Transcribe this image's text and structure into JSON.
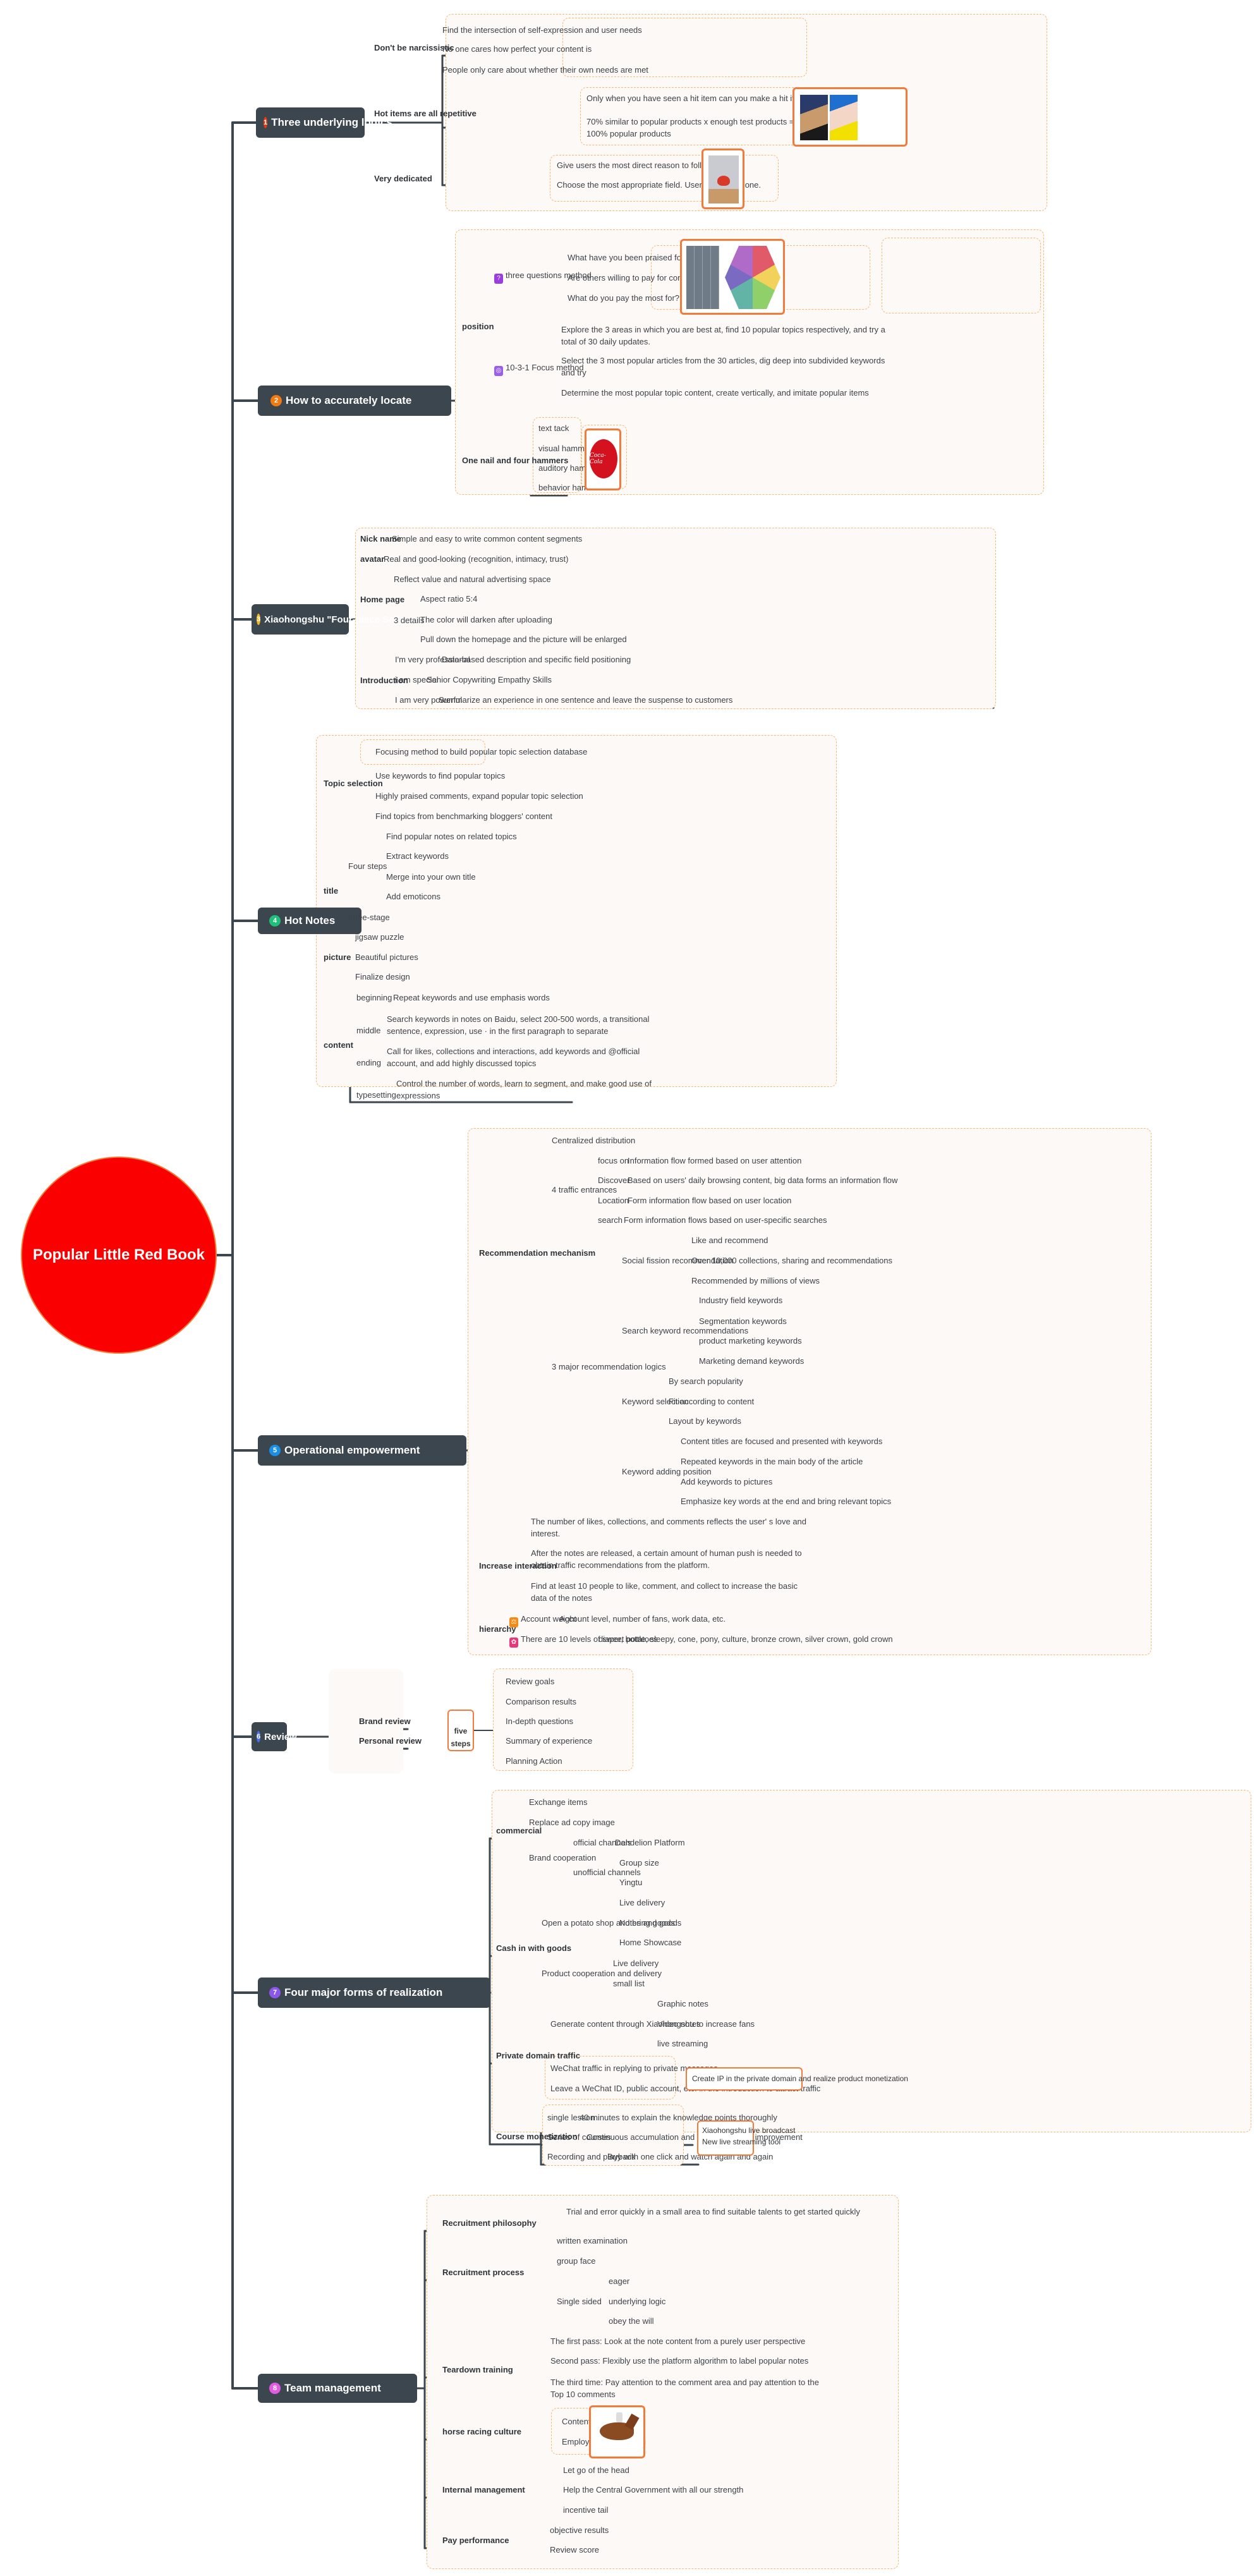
{
  "root": {
    "label": "Popular Little Red Book",
    "color": "#fb0000"
  },
  "topics": [
    {
      "num": "1",
      "label": "Three underlying logics",
      "badge_color": "#e8380d"
    },
    {
      "num": "2",
      "label": "How to accurately locate",
      "badge_color": "#f07a10"
    },
    {
      "num": "3",
      "label": "Xiaohongshu \"Four-piece Set\"",
      "badge_color": "#f3b61d"
    },
    {
      "num": "4",
      "label": "Hot Notes",
      "badge_color": "#1fc07a"
    },
    {
      "num": "5",
      "label": "Operational empowerment",
      "badge_color": "#1a8fe8"
    },
    {
      "num": "6",
      "label": "Review",
      "badge_color": "#4a6ef0"
    },
    {
      "num": "7",
      "label": "Four major forms of realization",
      "badge_color": "#8a57e8"
    },
    {
      "num": "8",
      "label": "Team management",
      "badge_color": "#e25ce3"
    }
  ],
  "t1": {
    "b1": "Don't be narcissistic",
    "b1_items": [
      "Find the intersection of self-expression and user needs",
      "No one cares how perfect your content is",
      "People only care about whether their own needs are met"
    ],
    "b2": "Hot items are all repetitive",
    "b2_items": [
      "Only when you have seen a hit item can you make a hit item",
      "70% similar to popular products x enough test products = 100% popular products"
    ],
    "b2_image": "girl-with-pearl-earring-comparison-image",
    "b3": "Very dedicated",
    "b3_items": [
      "Give users the most direct reason to follow you",
      "Choose the most appropriate field. Users like you alone."
    ],
    "b3_image": "hamster-with-heart-image"
  },
  "t2": {
    "position": "position",
    "three_q": "three questions method",
    "three_q_items": [
      "What have you been praised for?",
      "Are others willing to pay for compliments on you?",
      "What do you pay the most for?"
    ],
    "focus": "10-3-1 Focus method",
    "focus_items": [
      "Explore the 3 areas in which you are best at, find 10 popular topics respectively, and try a total of 30 daily updates.",
      "Select the 3 most popular articles from the 30 articles, dig deep into subdivided keywords and try",
      "Determine the most popular topic content, create vertically, and imitate popular items"
    ],
    "hammers": "One nail and four hammers",
    "hammer_items": [
      "text tack",
      "visual hammer",
      "auditory hammer",
      "behavior hammer"
    ],
    "brand_logo": "Coca-Cola"
  },
  "t3": {
    "nick": "Nick name",
    "nick_v": "Simple and easy to write common content segments",
    "avatar": "avatar",
    "avatar_v": "Real and good-looking (recognition, intimacy, trust)",
    "home": "Home page",
    "home_v": "Reflect value and natural advertising space",
    "details": "3 details",
    "details_items": [
      "Aspect ratio 5:4",
      "The color will darken after uploading",
      "Pull down the homepage and the picture will be enlarged"
    ],
    "intro": "Introduction",
    "intro_items": [
      {
        "k": "I'm very professional",
        "v": "Data-based description and specific field positioning"
      },
      {
        "k": "i am special",
        "v": "Senior Copywriting Empathy Skills"
      },
      {
        "k": "I am very powerful",
        "v": "Summarize an experience in one sentence and leave the suspense to customers"
      }
    ]
  },
  "t4": {
    "topic": "Topic selection",
    "topic_items": [
      "Focusing method to build popular topic selection database",
      "Use keywords to find popular topics",
      "Highly praised comments, expand popular topic selection",
      "Find topics from benchmarking bloggers'  content"
    ],
    "title": "title",
    "four": "Four steps",
    "four_items": [
      "Find popular notes on related topics",
      "Extract keywords",
      "Merge into your own title",
      "Add emoticons"
    ],
    "three": "three-stage",
    "picture": "picture",
    "picture_items": [
      "jigsaw puzzle",
      "Beautiful pictures",
      "Finalize design"
    ],
    "content": "content",
    "content_items": [
      {
        "k": "beginning",
        "v": "Repeat keywords and use emphasis words"
      },
      {
        "k": "middle",
        "v": "Search keywords in notes on Baidu, select 200-500 words, a transitional sentence, expression, use · in the first paragraph to separate"
      },
      {
        "k": "ending",
        "v": "Call for likes, collections and interactions, add keywords and @official account, and add highly discussed topics"
      },
      {
        "k": "typesetting",
        "v": "Control the number of words, learn to segment, and make good use of expressions"
      }
    ]
  },
  "t5": {
    "rec": "Recommendation mechanism",
    "central": "Centralized distribution",
    "entr": "4 traffic entrances",
    "entr_items": [
      {
        "k": "focus on",
        "v": "Information flow formed based on user attention"
      },
      {
        "k": "Discover",
        "v": "Based on users'  daily browsing content, big data forms an information flow"
      },
      {
        "k": "Location",
        "v": "Form information flow based on user location"
      },
      {
        "k": "search",
        "v": "Form information flows based on user-specific searches"
      }
    ],
    "logic": "3 major recommendation logics",
    "social": "Social fission recommendation",
    "social_items": [
      "Like and recommend",
      "Over 10,000 collections, sharing and recommendations",
      "Recommended by millions of views"
    ],
    "search_kw": "Search keyword recommendations",
    "search_items": [
      "Industry field keywords",
      "Segmentation keywords",
      "product marketing keywords",
      "Marketing demand keywords"
    ],
    "kw_sel": "Keyword selection",
    "kw_sel_items": [
      "By search popularity",
      "Fit according to content",
      "Layout by keywords"
    ],
    "kw_pos": "Keyword adding position",
    "kw_pos_items": [
      "Content titles are focused and presented with keywords",
      "Repeated keywords in the main body of the article",
      "Add keywords to pictures",
      "Emphasize key words at the end and bring relevant topics"
    ],
    "inter": "Increase interaction",
    "inter_items": [
      "The number of likes, collections, and comments reflects the user' s love and interest.",
      "After the notes are released, a certain amount of human push is needed to obtain traffic recommendations from the platform.",
      "Find at least 10 people to like, comment, and collect to increase the basic data of the notes"
    ],
    "hier": "hierarchy",
    "hier_items": [
      {
        "k": "Account weight",
        "v": "Account level, number of fans, work data, etc."
      },
      {
        "k": "There are 10 levels of sweet potatoes",
        "v": "diaper, bottle, sleepy, cone, pony, culture, bronze crown, silver crown, gold crown"
      }
    ]
  },
  "t6": {
    "brand": "Brand review",
    "personal": "Personal review",
    "five": "five steps",
    "five_items": [
      "Review goals",
      "Comparison results",
      "In-depth questions",
      "Summary of experience",
      "Planning Action"
    ]
  },
  "t7": {
    "commercial": "commercial",
    "exchange": "Exchange items",
    "replace": "Replace ad copy image",
    "brandcoop": "Brand cooperation",
    "official": "official channels",
    "dandelion": "Dandelion Platform",
    "unofficial": "unofficial channels",
    "unofficial_items": [
      "Group size",
      "Yingtu"
    ],
    "cash": "Cash in with goods",
    "potato": "Open a potato shop and bring goods",
    "potato_items": [
      "Live delivery",
      "Notes and goods",
      "Home Showcase"
    ],
    "prodcoop": "Product cooperation and delivery",
    "prodcoop_items": [
      "Live delivery",
      "small list"
    ],
    "private": "Private domain traffic",
    "generate": "Generate content through Xiaohongshu to increase fans",
    "generate_items": [
      "Graphic notes",
      "Video notes",
      "live streaming"
    ],
    "wechat_items": [
      "WeChat traffic in replying to private messages",
      "Leave a WeChat ID, public account, etc. in the introduction to attract traffic"
    ],
    "private_callout": "Create IP in the private domain and realize product monetization",
    "course": "Course monetization",
    "course_items": [
      {
        "k": "single lesson",
        "v": "40 minutes to explain the knowledge points thoroughly"
      },
      {
        "k": "Series of courses",
        "v": "Continuous accumulation and comprehensive improvement"
      },
      {
        "k": "Recording and playback",
        "v": "Buy with one click and watch again and again"
      }
    ],
    "course_callout": [
      "Xiaohongshu live broadcast",
      "New live streaming tool"
    ]
  },
  "t8": {
    "philo": "Recruitment philosophy",
    "philo_v": "Trial and error quickly in a small area to find suitable talents to get started quickly",
    "process": "Recruitment process",
    "written": "written examination",
    "group": "group face",
    "single": "Single sided",
    "single_items": [
      "eager",
      "underlying logic",
      "obey the will"
    ],
    "teardown": "Teardown training",
    "teardown_items": [
      "The first pass: Look at the note content from a purely user perspective",
      "Second pass: Flexibly use the platform algorithm to label popular notes",
      "The third time: Pay attention to the comment area and pay attention to the Top 10 comments"
    ],
    "horse": "horse racing culture",
    "horse_items": [
      "Content horse racing",
      "Employee horse racing"
    ],
    "horse_image": "racing-horse-jockey-image",
    "internal": "Internal management",
    "internal_items": [
      "Let go of the head",
      "Help the Central Government with all our strength",
      "incentive tail"
    ],
    "pay": "Pay performance",
    "pay_items": [
      "objective results",
      "Review score"
    ]
  },
  "colors": {
    "line": "#3c464f",
    "summary_border": "#f7b873",
    "callout_border": "#f47a3a"
  }
}
